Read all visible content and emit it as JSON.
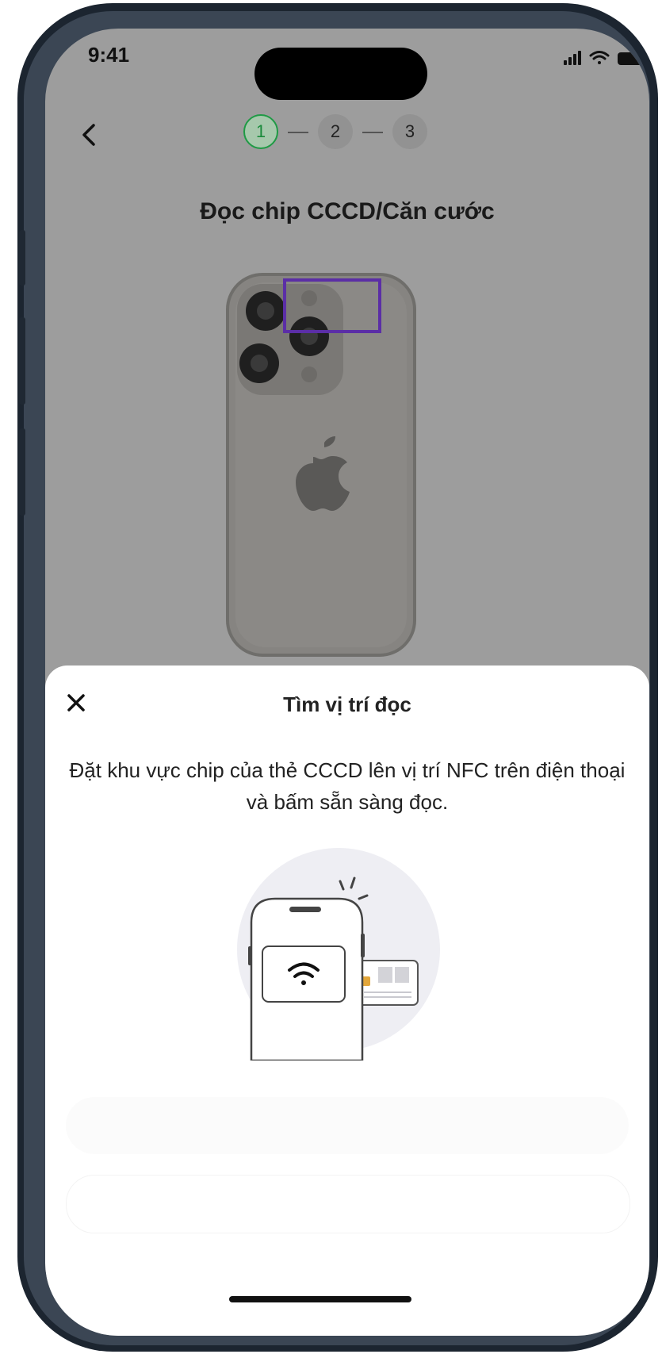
{
  "status_bar": {
    "time": "9:41"
  },
  "nav": {
    "back_icon": "chevron-left-icon"
  },
  "stepper": {
    "steps": [
      "1",
      "2",
      "3"
    ],
    "active_index": 0
  },
  "page": {
    "title": "Đọc chip CCCD/Căn cước"
  },
  "sheet": {
    "title": "Tìm vị trí đọc",
    "description": "Đặt khu vực chip của thẻ CCCD lên vị trí NFC trên điện thoại và bấm sẵn sàng đọc.",
    "close_icon": "close-icon"
  },
  "colors": {
    "step_active": "#1f9a45",
    "highlight_box": "#5b2ea6",
    "overlay": "#9d9d9d"
  }
}
